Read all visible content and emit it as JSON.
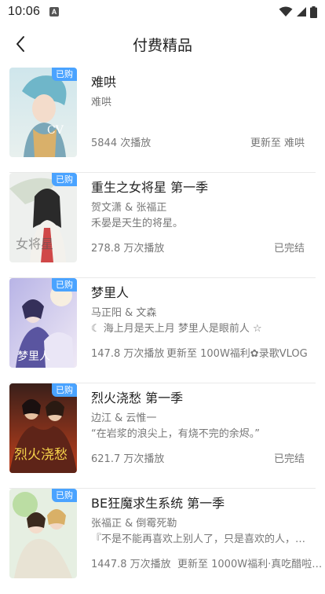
{
  "status_bar": {
    "time": "10:06",
    "notif_letter": "A"
  },
  "header": {
    "title": "付费精品"
  },
  "items": [
    {
      "title": "难哄",
      "sub1": "难哄",
      "sub2": "",
      "plays": "5844 次播放",
      "status": "更新至 难哄",
      "badge": "已购"
    },
    {
      "title": "重生之女将星 第一季",
      "sub1": "贺文潇 & 张福正",
      "sub2": "禾晏是天生的将星。",
      "plays": "278.8 万次播放",
      "status": "已完结",
      "badge": "已购"
    },
    {
      "title": "梦里人",
      "sub1": "马正阳 & 文森",
      "sub2": "☾ 海上月是天上月 梦里人是眼前人 ☆",
      "plays": "147.8 万次播放",
      "status": "更新至 100W福利✿录歌VLOG",
      "badge": "已购"
    },
    {
      "title": "烈火浇愁 第一季",
      "sub1": "边江 & 云惟一",
      "sub2": "“在岩浆的浪尖上，有烧不完的余烬。”",
      "plays": "621.7 万次播放",
      "status": "已完结",
      "badge": "已购"
    },
    {
      "title": "BE狂魔求生系统 第一季",
      "sub1": "张福正 & 倒霉死勒",
      "sub2": "『不是不能再喜欢上别人了，只是喜欢的人，…",
      "plays": "1447.8 万次播放",
      "status": "更新至 1000W福利·真吃醋啦…",
      "badge": "已购"
    }
  ]
}
